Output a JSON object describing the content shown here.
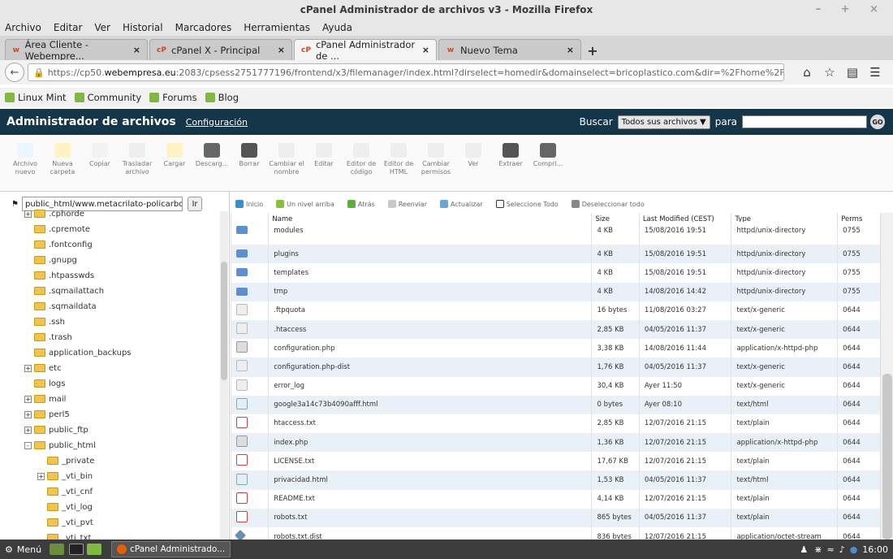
{
  "window": {
    "title": "cPanel Administrador de archivos v3 - Mozilla Firefox"
  },
  "menubar": [
    "Archivo",
    "Editar",
    "Ver",
    "Historial",
    "Marcadores",
    "Herramientas",
    "Ayuda"
  ],
  "tabs": [
    {
      "label": "Área Cliente - Webempre...",
      "favicon": "w",
      "active": false
    },
    {
      "label": "cPanel X - Principal",
      "favicon": "cP",
      "active": false
    },
    {
      "label": "cPanel Administrador de ...",
      "favicon": "cP",
      "active": true
    },
    {
      "label": "Nuevo Tema",
      "favicon": "w",
      "active": false
    }
  ],
  "url": {
    "prefix": "https://cp50.",
    "host": "webempresa.eu",
    "rest": ":2083/cpsess2751777196/frontend/x3/filemanager/index.html?dirselect=homedir&domainselect=bricoplastico.com&dir=%2Fhome%2Fmotocant&showhidde"
  },
  "bookmarks": [
    "Linux Mint",
    "Community",
    "Forums",
    "Blog"
  ],
  "cp": {
    "title": "Administrador de archivos",
    "config": "Configuración",
    "search_label": "Buscar",
    "search_scope": "Todos sus archivos",
    "para": "para",
    "go": "GO"
  },
  "toolbar": [
    "Archivo nuevo",
    "Nueva carpeta",
    "Copiar",
    "Trasladar archivo",
    "Cargar",
    "Descarg...",
    "Borrar",
    "Cambiar el nombre",
    "Editar",
    "Editor de código",
    "Editor de HTML",
    "Cambiar permisos",
    "Ver",
    "Extraer",
    "Compri..."
  ],
  "sidebar": {
    "path": "public_html/www.metacrilato-policarbon",
    "ir": "Ir",
    "items": [
      {
        "label": ".cphorde",
        "indent": 30,
        "expander": "+"
      },
      {
        "label": ".cpremote",
        "indent": 42,
        "expander": ""
      },
      {
        "label": ".fontconfig",
        "indent": 42,
        "expander": ""
      },
      {
        "label": ".gnupg",
        "indent": 42,
        "expander": ""
      },
      {
        "label": ".htpasswds",
        "indent": 42,
        "expander": ""
      },
      {
        "label": ".sqmailattach",
        "indent": 42,
        "expander": ""
      },
      {
        "label": ".sqmaildata",
        "indent": 42,
        "expander": ""
      },
      {
        "label": ".ssh",
        "indent": 42,
        "expander": ""
      },
      {
        "label": ".trash",
        "indent": 42,
        "expander": ""
      },
      {
        "label": "application_backups",
        "indent": 42,
        "expander": ""
      },
      {
        "label": "etc",
        "indent": 30,
        "expander": "+"
      },
      {
        "label": "logs",
        "indent": 42,
        "expander": ""
      },
      {
        "label": "mail",
        "indent": 30,
        "expander": "+"
      },
      {
        "label": "perl5",
        "indent": 30,
        "expander": "+"
      },
      {
        "label": "public_ftp",
        "indent": 30,
        "expander": "+"
      },
      {
        "label": "public_html",
        "indent": 30,
        "expander": "-"
      },
      {
        "label": "_private",
        "indent": 58,
        "expander": ""
      },
      {
        "label": "_vti_bin",
        "indent": 46,
        "expander": "+"
      },
      {
        "label": "_vti_cnf",
        "indent": 58,
        "expander": ""
      },
      {
        "label": "_vti_log",
        "indent": 58,
        "expander": ""
      },
      {
        "label": "_vti_pvt",
        "indent": 58,
        "expander": ""
      },
      {
        "label": "_vti_txt",
        "indent": 58,
        "expander": ""
      }
    ]
  },
  "navrow": [
    "Inicio",
    "Un nivel arriba",
    "Atrás",
    "Reenviar",
    "Actualizar",
    "Seleccione Todo",
    "Deseleccionar todo"
  ],
  "columns": [
    "Name",
    "Size",
    "Last Modified (CEST)",
    "Type",
    "Perms"
  ],
  "files": [
    {
      "icon": "folder",
      "name": "modules",
      "size": "4 KB",
      "date": "15/08/2016 19:51",
      "type": "httpd/unix-directory",
      "perms": "0755"
    },
    {
      "icon": "folder",
      "name": "plugins",
      "size": "4 KB",
      "date": "15/08/2016 19:51",
      "type": "httpd/unix-directory",
      "perms": "0755"
    },
    {
      "icon": "folder",
      "name": "templates",
      "size": "4 KB",
      "date": "15/08/2016 19:51",
      "type": "httpd/unix-directory",
      "perms": "0755"
    },
    {
      "icon": "folder",
      "name": "tmp",
      "size": "4 KB",
      "date": "14/08/2016 14:42",
      "type": "httpd/unix-directory",
      "perms": "0755"
    },
    {
      "icon": "generic",
      "name": ".ftpquota",
      "size": "16 bytes",
      "date": "11/08/2016 03:27",
      "type": "text/x-generic",
      "perms": "0644"
    },
    {
      "icon": "generic",
      "name": ".htaccess",
      "size": "2,85 KB",
      "date": "04/05/2016 11:37",
      "type": "text/x-generic",
      "perms": "0644"
    },
    {
      "icon": "php",
      "name": "configuration.php",
      "size": "3,38 KB",
      "date": "14/08/2016 11:44",
      "type": "application/x-httpd-php",
      "perms": "0644"
    },
    {
      "icon": "generic",
      "name": "configuration.php-dist",
      "size": "1,76 KB",
      "date": "04/05/2016 11:37",
      "type": "text/x-generic",
      "perms": "0644"
    },
    {
      "icon": "generic",
      "name": "error_log",
      "size": "30,4 KB",
      "date": "Ayer 11:50",
      "type": "text/x-generic",
      "perms": "0644"
    },
    {
      "icon": "html",
      "name": "google3a14c73b4090afff.html",
      "size": "0 bytes",
      "date": "Ayer 08:10",
      "type": "text/html",
      "perms": "0644"
    },
    {
      "icon": "text",
      "name": "htaccess.txt",
      "size": "2,85 KB",
      "date": "12/07/2016 21:15",
      "type": "text/plain",
      "perms": "0644"
    },
    {
      "icon": "php",
      "name": "index.php",
      "size": "1,36 KB",
      "date": "12/07/2016 21:15",
      "type": "application/x-httpd-php",
      "perms": "0644"
    },
    {
      "icon": "text",
      "name": "LICENSE.txt",
      "size": "17,67 KB",
      "date": "12/07/2016 21:15",
      "type": "text/plain",
      "perms": "0644"
    },
    {
      "icon": "html",
      "name": "privacidad.html",
      "size": "1,53 KB",
      "date": "04/05/2016 11:37",
      "type": "text/html",
      "perms": "0644"
    },
    {
      "icon": "text",
      "name": "README.txt",
      "size": "4,14 KB",
      "date": "12/07/2016 21:15",
      "type": "text/plain",
      "perms": "0644"
    },
    {
      "icon": "text",
      "name": "robots.txt",
      "size": "865 bytes",
      "date": "04/05/2016 11:37",
      "type": "text/plain",
      "perms": "0644"
    },
    {
      "icon": "octet",
      "name": "robots.txt.dist",
      "size": "836 bytes",
      "date": "12/07/2016 21:15",
      "type": "application/octet-stream",
      "perms": "0644"
    }
  ],
  "taskbar": {
    "menu": "Menú",
    "item": "cPanel Administrado...",
    "time": "16:00"
  }
}
